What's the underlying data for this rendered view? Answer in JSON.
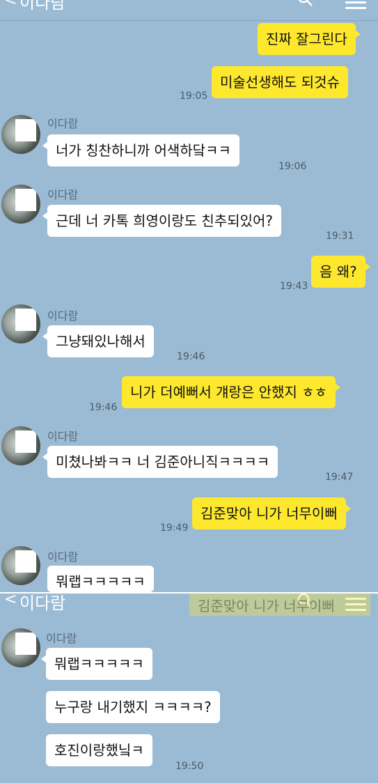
{
  "header": {
    "back_glyph": "<",
    "title": "이다람",
    "icons": [
      "search-icon",
      "menu-icon"
    ]
  },
  "contact_name": "이다람",
  "messages": {
    "m1": {
      "text": "진짜 잘그린다"
    },
    "m2": {
      "text": "미술선생해도 되것슈",
      "time": "19:05"
    },
    "m3": {
      "text": "너가 칭찬하니까 어색하닼ㅋㅋ",
      "time": "19:06"
    },
    "m4": {
      "text": "근데 너 카톡 희영이랑도 친추되있어?",
      "time": "19:31"
    },
    "m5": {
      "text": "음 왜?",
      "time": "19:43"
    },
    "m6": {
      "text": "그냥돼있나해서",
      "time": "19:46"
    },
    "m7": {
      "text": "니가 더예뻐서 걔랑은 안했지 ㅎㅎ",
      "time": "19:46"
    },
    "m8": {
      "text": "미쳤나봐ㅋㅋ 너 김준아니직ㅋㅋㅋㅋ",
      "time": "19:47"
    },
    "m9": {
      "text": "김준맞아 니가 너무이뻐",
      "time": "19:49"
    },
    "m10": {
      "text": "뭐랩ㅋㅋㅋㅋㅋ"
    }
  },
  "second_screenshot": {
    "header_title": "이다람",
    "ghost_preview": "김준맞아 니가 너무이뻐",
    "m11": {
      "text": "뭐랩ㅋㅋㅋㅋㅋ"
    },
    "m12": {
      "text": "누구랑 내기했지 ㅋㅋㅋㅋ?"
    },
    "m13": {
      "text": "호진이랑했닠ㅋ",
      "time": "19:50"
    }
  },
  "colors": {
    "background": "#9bbbd4",
    "my_bubble": "#fde82e",
    "their_bubble": "#ffffff"
  }
}
